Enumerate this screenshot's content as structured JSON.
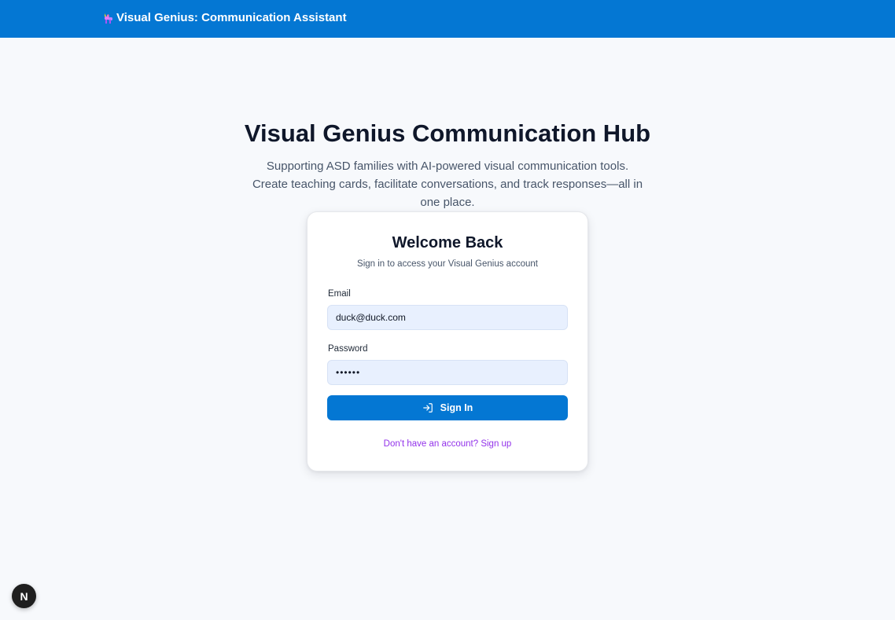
{
  "header": {
    "app_title": "Visual Genius: Communication Assistant",
    "logo_icon": "unicorn-icon",
    "bg_color": "#0477d3"
  },
  "hero": {
    "title": "Visual Genius Communication Hub",
    "subtitle": "Supporting ASD families with AI-powered visual communication tools. Create teaching cards, facilitate conversations, and track responses—all in one place."
  },
  "login_card": {
    "title": "Welcome Back",
    "subtitle": "Sign in to access your Visual Genius account",
    "email": {
      "label": "Email",
      "value": "duck@duck.com"
    },
    "password": {
      "label": "Password",
      "value": "••••••"
    },
    "submit": {
      "label": "Sign In",
      "icon": "log-in-icon"
    },
    "signup_link": "Don't have an account? Sign up"
  },
  "dev_badge": {
    "label": "N",
    "icon": "nextjs-icon"
  },
  "colors": {
    "primary": "#0477d3",
    "link": "#9333ea",
    "input_bg": "#e8f0fe",
    "page_bg": "#f7f9fc"
  }
}
